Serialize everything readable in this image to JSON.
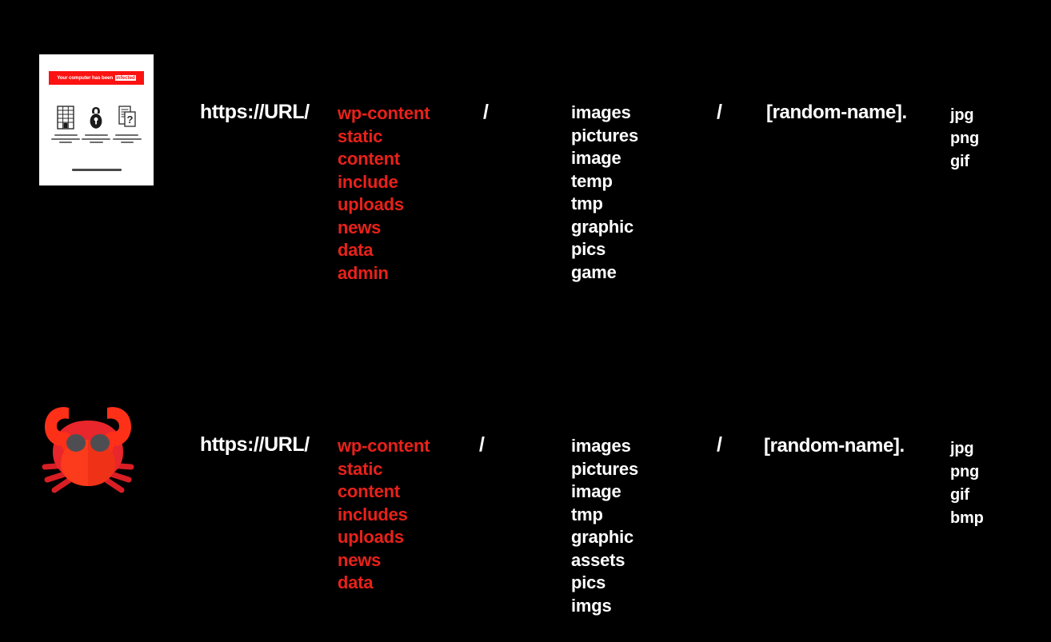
{
  "background_color": "#000000",
  "accent_red": "#e8211a",
  "text_white": "#ffffff",
  "rows": [
    {
      "id": "row-1",
      "artwork": {
        "type": "ransom-note-thumbnail",
        "banner_text": "Your computer has been",
        "banner_emphasis": "infected"
      },
      "host": "https://URL/",
      "separator_1": "/",
      "separator_2": "/",
      "filename": "[random-name].",
      "paths": [
        "wp-content",
        "static",
        "content",
        "include",
        "uploads",
        "news",
        "data",
        "admin"
      ],
      "directories": [
        "images",
        "pictures",
        "image",
        "temp",
        "tmp",
        "graphic",
        "pics",
        "game"
      ],
      "extensions": [
        "jpg",
        "png",
        "gif"
      ]
    },
    {
      "id": "row-2",
      "artwork": {
        "type": "crab-icon"
      },
      "host": "https://URL/",
      "separator_1": "/",
      "separator_2": "/",
      "filename": "[random-name].",
      "paths": [
        "wp-content",
        "static",
        "content",
        "includes",
        "uploads",
        "news",
        "data"
      ],
      "directories": [
        "images",
        "pictures",
        "image",
        "tmp",
        "graphic",
        "assets",
        "pics",
        "imgs"
      ],
      "extensions": [
        "jpg",
        "png",
        "gif",
        "bmp"
      ]
    }
  ]
}
